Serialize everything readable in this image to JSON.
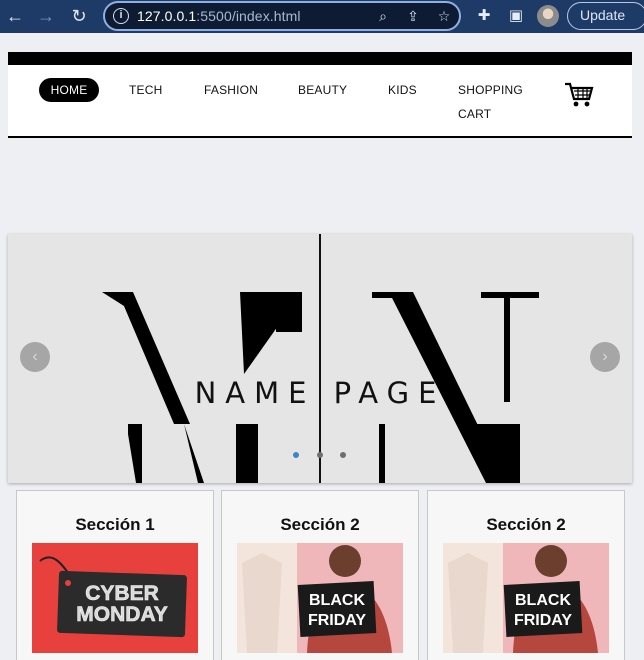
{
  "browser": {
    "url_host": "127.0.0.1",
    "url_rest": ":5500/index.html",
    "update_label": "Update"
  },
  "nav": {
    "items": [
      {
        "label": "HOME",
        "active": true
      },
      {
        "label": "TECH"
      },
      {
        "label": "FASHION"
      },
      {
        "label": "BEAUTY"
      },
      {
        "label": "KIDS"
      },
      {
        "label": "SHOPPING"
      }
    ],
    "cart_label": "CART",
    "cart_icon": "shopping-cart-icon"
  },
  "carousel": {
    "logo_letters": "MN",
    "brand_text": "NAME PAGE",
    "prev_icon": "chevron-left-icon",
    "next_icon": "chevron-right-icon",
    "slide_count": 3,
    "active_slide": 1
  },
  "sections": [
    {
      "title": "Sección 1",
      "image_text_1": "CYBER",
      "image_text_2": "MONDAY"
    },
    {
      "title": "Sección 2",
      "image_text_1": "BLACK",
      "image_text_2": "FRIDAY"
    },
    {
      "title": "Sección 2",
      "image_text_1": "BLACK",
      "image_text_2": "FRIDAY"
    }
  ]
}
